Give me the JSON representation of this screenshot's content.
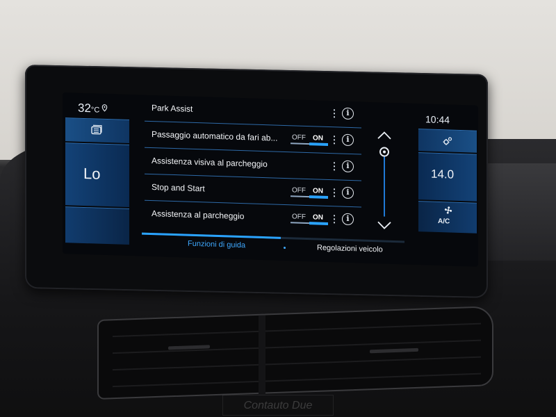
{
  "climate_left": {
    "temperature": "32",
    "temperature_unit": "°C",
    "fan_level": "Lo"
  },
  "settings": {
    "items": [
      {
        "label": "Park Assist",
        "has_toggle": false
      },
      {
        "label": "Passaggio automatico da fari ab...",
        "has_toggle": true,
        "off_label": "OFF",
        "on_label": "ON",
        "state": "on"
      },
      {
        "label": "Assistenza visiva al parcheggio",
        "has_toggle": false
      },
      {
        "label": "Stop and Start",
        "has_toggle": true,
        "off_label": "OFF",
        "on_label": "ON",
        "state": "on"
      },
      {
        "label": "Assistenza al parcheggio",
        "has_toggle": true,
        "off_label": "OFF",
        "on_label": "ON",
        "state": "on"
      }
    ]
  },
  "climate_right": {
    "clock": "10:44",
    "temperature_setting": "14.0",
    "ac_label": "A/C"
  },
  "tabs": [
    {
      "label": "Funzioni di guida",
      "active": true
    },
    {
      "label": "Regolazioni veicolo",
      "active": false
    }
  ],
  "watermark": "Contauto Due",
  "colors": {
    "accent": "#2aa3ff",
    "panel_blue": "#134277",
    "screen_bg": "#06080c"
  }
}
